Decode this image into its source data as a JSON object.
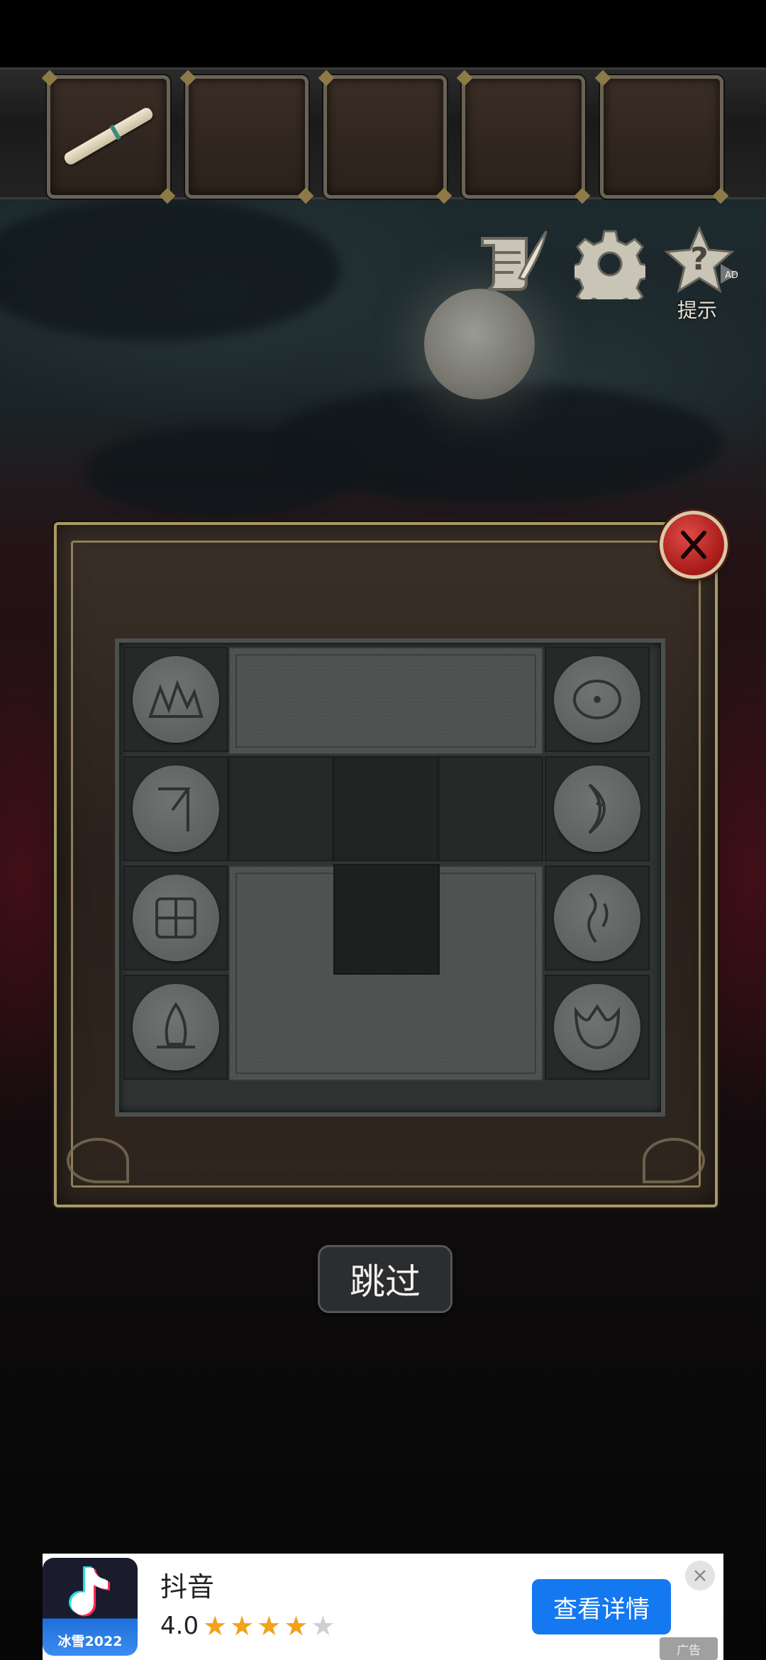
{
  "game": {
    "hint_label": "提示",
    "hint_ad_badge": "AD",
    "skip_label": "跳过",
    "inventory": [
      "scroll",
      "empty",
      "empty",
      "empty",
      "empty"
    ],
    "left_runes": [
      "mountain-rune-icon",
      "gallows-rune-icon",
      "window-rune-icon",
      "flame-rune-icon"
    ],
    "right_runes": [
      "sun-rune-icon",
      "moon-rune-icon",
      "water-rune-icon",
      "flower-rune-icon"
    ]
  },
  "ad": {
    "app_name": "抖音",
    "logo_text": "冰雪2022",
    "rating": "4.0",
    "stars_filled": 4,
    "stars_total": 5,
    "cta_label": "查看详情",
    "tag": "广告"
  },
  "colors": {
    "close_red": "#c22a27",
    "cta_blue": "#1478f0",
    "star_gold": "#f2a21b",
    "panel_gold": "#a99968"
  }
}
